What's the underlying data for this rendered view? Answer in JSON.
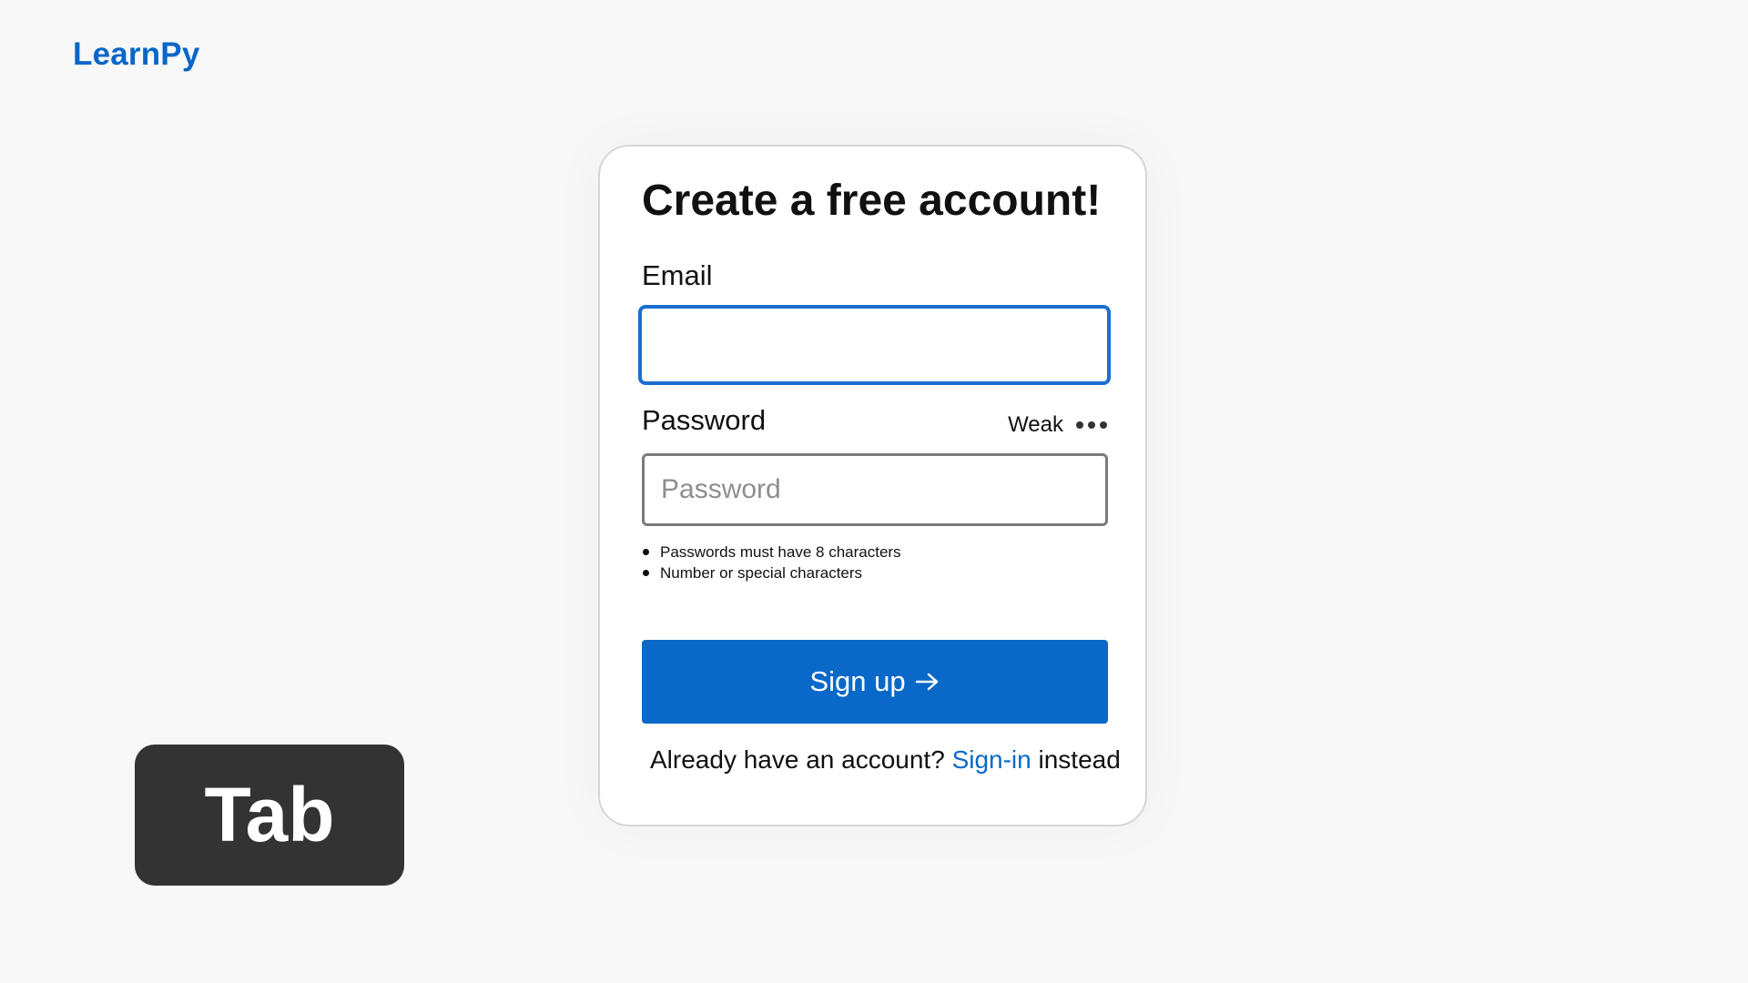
{
  "logo": {
    "text": "LearnPy"
  },
  "form": {
    "title": "Create a free account!",
    "email_label": "Email",
    "email_value": "",
    "password_label": "Password",
    "password_placeholder": "Password",
    "password_strength": "Weak",
    "password_rules": [
      "Passwords must have 8 characters",
      "Number or special characters"
    ],
    "signup_label": "Sign up",
    "signin_prefix": "Already have an account?",
    "signin_link": "Sign-in",
    "signin_suffix": "instead"
  },
  "key_hint": {
    "label": "Tab"
  },
  "colors": {
    "brand": "#0a69c8",
    "focus_border": "#1a6ed0",
    "key_badge": "#333333"
  },
  "icons": {
    "more": "ellipsis-icon",
    "arrow": "arrow-right-icon"
  }
}
